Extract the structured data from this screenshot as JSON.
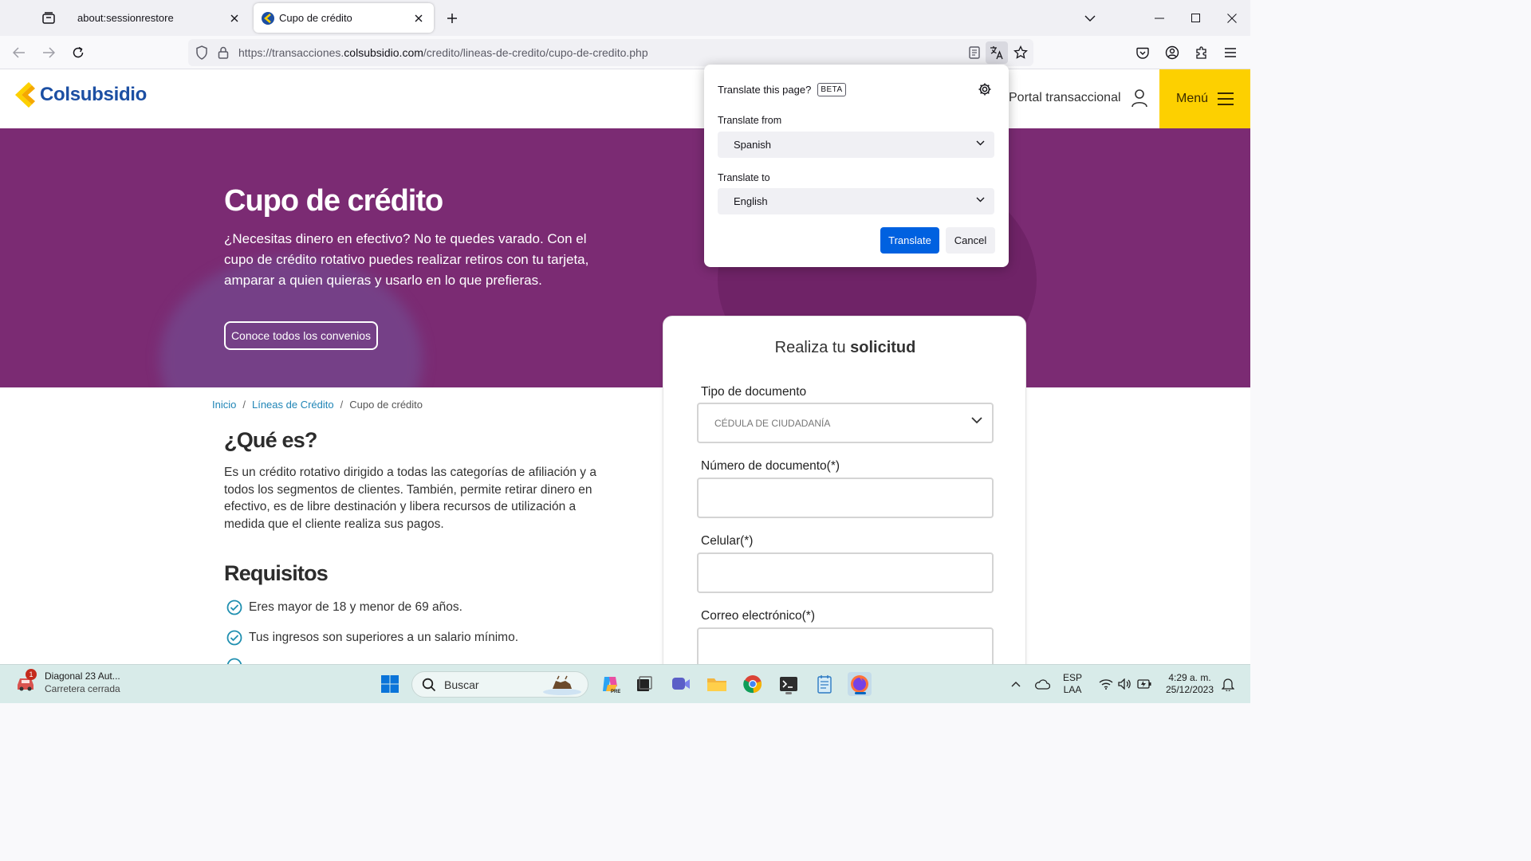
{
  "browser": {
    "tabs": [
      {
        "title": "about:sessionrestore",
        "active": false
      },
      {
        "title": "Cupo de crédito",
        "active": true
      }
    ],
    "url_prefix": "https://transacciones.",
    "url_domain": "colsubsidio.com",
    "url_path": "/credito/lineas-de-credito/cupo-de-credito.php"
  },
  "translate_popup": {
    "title": "Translate this page?",
    "badge": "BETA",
    "from_label": "Translate from",
    "from_value": "Spanish",
    "to_label": "Translate to",
    "to_value": "English",
    "translate_button": "Translate",
    "cancel_button": "Cancel"
  },
  "site": {
    "logo_text": "Colsubsidio",
    "portal_link": "Portal transaccional",
    "menu_label": "Menú",
    "hero": {
      "title": "Cupo de crédito",
      "text": "¿Necesitas dinero en efectivo? No te quedes varado. Con el cupo de crédito rotativo puedes realizar retiros con tu tarjeta, amparar a quien quieras y usarlo en lo que prefieras.",
      "button": "Conoce todos los convenios"
    },
    "breadcrumb": {
      "home": "Inicio",
      "section": "Líneas de Crédito",
      "current": "Cupo de crédito",
      "separator": "/"
    },
    "que_es": {
      "title": "¿Qué es?",
      "text": "Es un crédito rotativo dirigido a todas las categorías de afiliación y a todos los segmentos de clientes. También, permite retirar dinero en efectivo, es de libre destinación y libera recursos de utilización a medida que el cliente realiza sus pagos."
    },
    "requisitos": {
      "title": "Requisitos",
      "items": [
        "Eres mayor de 18 y menor de 69 años.",
        "Tus ingresos son superiores a un salario mínimo."
      ]
    },
    "form": {
      "title_regular": "Realiza tu ",
      "title_bold": "solicitud",
      "doc_type_label": "Tipo de documento",
      "doc_type_value": "CÉDULA DE CIUDADANÍA",
      "doc_number_label": "Número de documento(*)",
      "phone_label": "Celular(*)",
      "email_label": "Correo electrónico(*)"
    }
  },
  "taskbar": {
    "weather_title": "Diagonal 23 Aut...",
    "weather_subtitle": "Carretera cerrada",
    "weather_badge": "1",
    "search_placeholder": "Buscar",
    "lang_top": "ESP",
    "lang_bottom": "LAA",
    "time": "4:29 a. m.",
    "date": "25/12/2023"
  },
  "colors": {
    "hero_purple": "#7b2b73",
    "brand_yellow": "#fdd000",
    "brand_blue": "#1c4fa3",
    "firefox_blue": "#0061e0",
    "check_teal": "#1f8fb0"
  }
}
